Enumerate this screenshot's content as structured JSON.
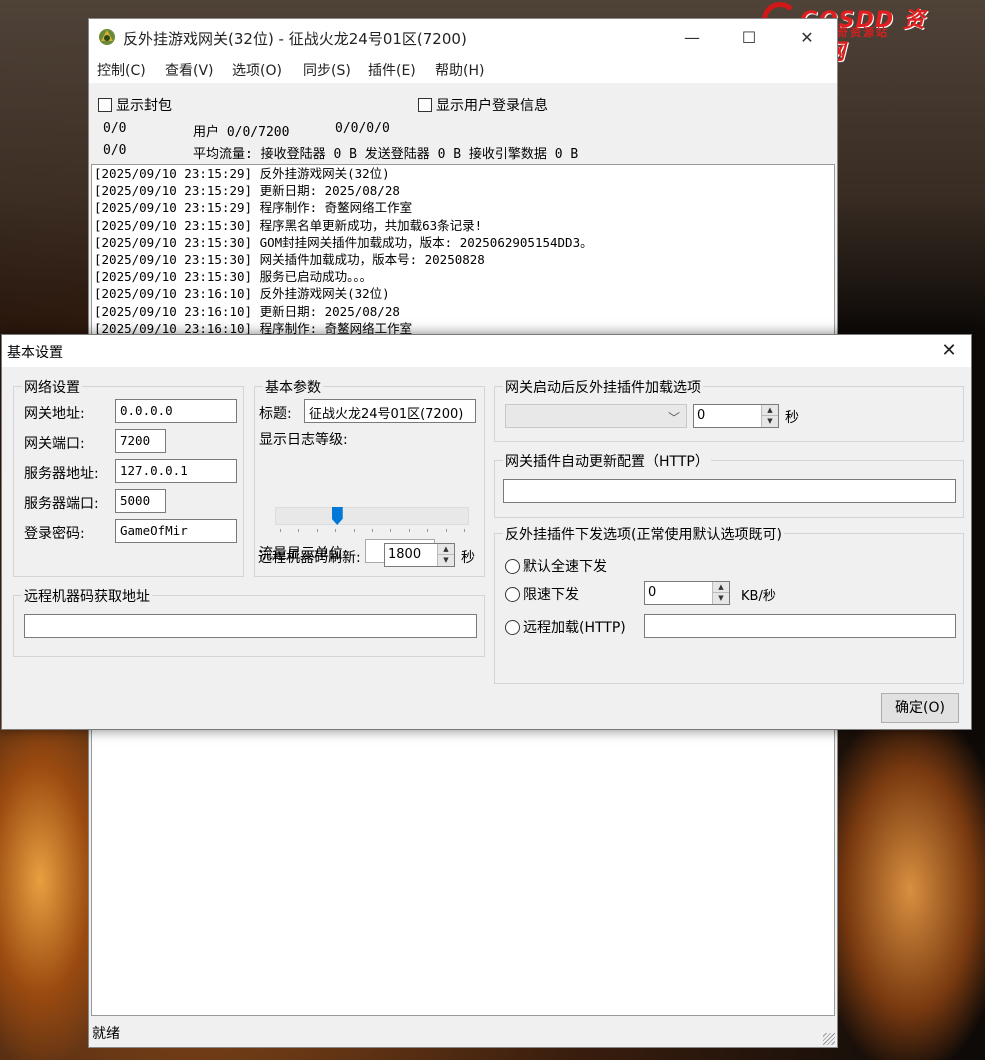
{
  "watermark": {
    "brand": "GOSDD 资源网",
    "tagline": "传奇资源站"
  },
  "window": {
    "title": "反外挂游戏网关(32位) - 征战火龙24号01区(7200)",
    "controls": [
      "—",
      "☐",
      "✕"
    ]
  },
  "menu": [
    "控制(C)",
    "查看(V)",
    "选项(O)",
    "同步(S)",
    "插件(E)",
    "帮助(H)"
  ],
  "top": {
    "show_packets": "显示封包",
    "show_login": "显示用户登录信息",
    "stat_a1": "0/0",
    "stat_a2": "用户 0/0/7200",
    "stat_a3": "0/0/0/0",
    "stat_b1": "0/0",
    "stat_b2": "平均流量: 接收登陆器 0 B 发送登陆器 0 B 接收引擎数据 0 B"
  },
  "log": [
    "[2025/09/10 23:15:29] 反外挂游戏网关(32位)",
    "[2025/09/10 23:15:29] 更新日期: 2025/08/28",
    "[2025/09/10 23:15:29] 程序制作: 奇鳌网络工作室",
    "[2025/09/10 23:15:30] 程序黑名单更新成功，共加载63条记录!",
    "[2025/09/10 23:15:30] GOM封挂网关插件加载成功，版本: 2025062905154DD3。",
    "[2025/09/10 23:15:30] 网关插件加载成功，版本号: 20250828",
    "[2025/09/10 23:15:30] 服务已启动成功。。。",
    "[2025/09/10 23:16:10] 反外挂游戏网关(32位)",
    "[2025/09/10 23:16:10] 更新日期: 2025/08/28",
    "[2025/09/10 23:16:10] 程序制作: 奇鳌网络工作室"
  ],
  "status": "就绪",
  "dialog": {
    "title": "基本设置",
    "close": "✕",
    "network": {
      "title": "网络设置",
      "gw_addr_label": "网关地址:",
      "gw_addr": "0.0.0.0",
      "gw_port_label": "网关端口:",
      "gw_port": "7200",
      "srv_addr_label": "服务器地址:",
      "srv_addr": "127.0.0.1",
      "srv_port_label": "服务器端口:",
      "srv_port": "5000",
      "pwd_label": "登录密码:",
      "pwd": "GameOfMir"
    },
    "basic": {
      "title": "基本参数",
      "title_label": "标题:",
      "title_value": "征战火龙24号01区(7200)",
      "log_level_label": "显示日志等级:",
      "log_level_fraction": 0.31,
      "traffic_unit_label": "流量显示单位:",
      "refresh_label": "远程机器码刷新:",
      "refresh_value": "1800",
      "refresh_unit": "秒"
    },
    "remote": {
      "title": "远程机器码获取地址",
      "value": ""
    },
    "plugin_load": {
      "title": "网关启动后反外挂插件加载选项",
      "spin_value": "0",
      "unit": "秒"
    },
    "auto_update": {
      "title": "网关插件自动更新配置（HTTP）",
      "value": ""
    },
    "dispatch": {
      "title": "反外挂插件下发选项(正常使用默认选项既可)",
      "opt1": "默认全速下发",
      "opt2": "限速下发",
      "speed_value": "0",
      "speed_unit": "KB/秒",
      "opt3": "远程加载(HTTP)",
      "remote_url": ""
    },
    "ok": "确定(O)"
  }
}
